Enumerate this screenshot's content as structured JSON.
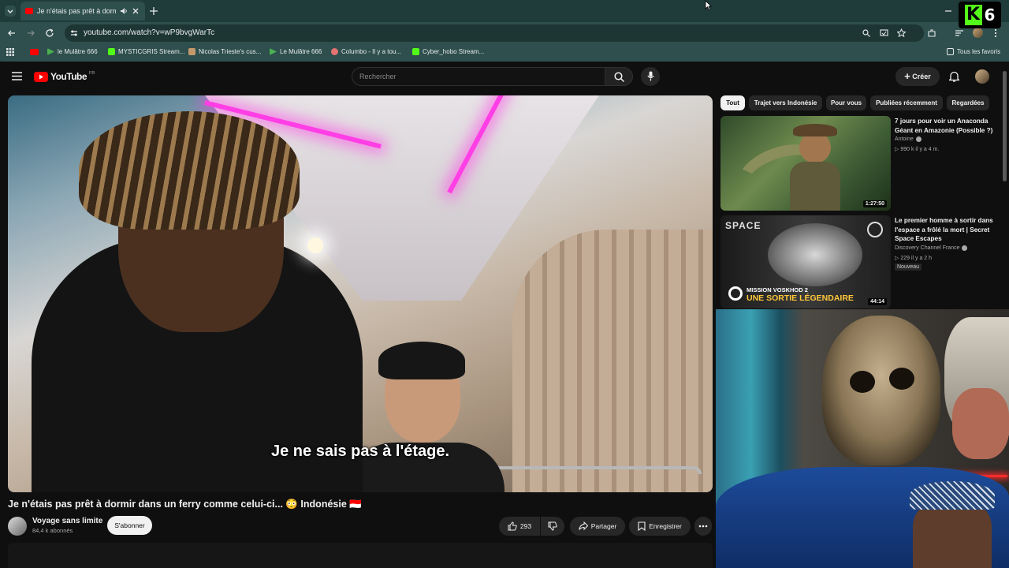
{
  "browser": {
    "tab_title": "Je n'étais pas prêt à dormir",
    "url": "youtube.com/watch?v=wP9bvgWarTc",
    "bookmarks": [
      {
        "label": "le Mulâtre 666",
        "color": "#4caf50"
      },
      {
        "label": "MYSTICGRIS Stream...",
        "color": "#53fc18"
      },
      {
        "label": "Nicolas Trieste's cus...",
        "color": "#c49a6c"
      },
      {
        "label": "Le Mulâtre 666",
        "color": "#4caf50"
      },
      {
        "label": "Columbo - Il y a tou...",
        "color": "#e57373"
      },
      {
        "label": "Cyber_hobo Stream...",
        "color": "#53fc18"
      }
    ],
    "all_bookmarks": "Tous les favoris"
  },
  "youtube": {
    "logo_text": "YouTube",
    "logo_region": "FR",
    "search_placeholder": "Rechercher",
    "create_label": "Créer"
  },
  "video": {
    "subtitle": "Je ne sais pas à l'étage.",
    "title": "Je n'étais pas prêt à dormir dans un ferry comme celui-ci... 😳 Indonésie 🇮🇩",
    "channel": "Voyage sans limite",
    "subscribers": "84,4 k abonnés",
    "subscribe_label": "S'abonner",
    "likes": "293",
    "share_label": "Partager",
    "save_label": "Enregistrer"
  },
  "sidebar": {
    "chips": [
      "Tout",
      "Trajet vers Indonésie",
      "Pour vous",
      "Publiées récemment",
      "Regardées"
    ],
    "videos": [
      {
        "title": "7 jours pour voir un Anaconda Géant en Amazonie (Possible ?)",
        "channel": "Antoine",
        "meta": "▷ 990 k   il y a 4 m.",
        "duration": "1:27:50"
      },
      {
        "title": "Le premier homme à sortir dans l'espace a frôlé la mort | Secret Space Escapes",
        "channel": "Discovery Channel France",
        "meta": "▷ 229   il y a 2 h",
        "badge": "Nouveau",
        "duration": "44:14",
        "thumb_top": "SPACE",
        "thumb_sub": "MISSION VOSKHOD 2",
        "thumb_main": "UNE SORTIE LÉGENDAIRE"
      }
    ]
  },
  "overlay": {
    "kick_letter": "K",
    "kick_number": "6"
  }
}
